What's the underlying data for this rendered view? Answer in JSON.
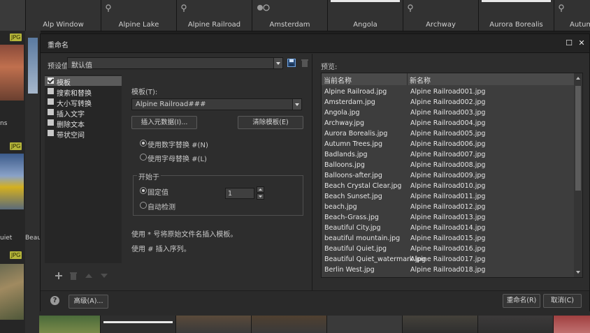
{
  "background": {
    "thumbnail_captions": [
      "Alp Window",
      "Alpine Lake",
      "Alpine Railroad",
      "Amsterdam",
      "Angola",
      "Archway",
      "Aurora Borealis",
      "Autumn"
    ],
    "side_badges": [
      "JPG",
      "JPG",
      "JPG"
    ],
    "side_captions": [
      "ns",
      "uiet",
      "Beau"
    ]
  },
  "dialog": {
    "title": "重命名",
    "maximize_glyph": "☐",
    "close_glyph": "✕",
    "preset_label": "预设值",
    "preset_value": "默认值",
    "template_items": [
      {
        "label": "模板",
        "checked": true,
        "selected": true
      },
      {
        "label": "搜索和替换",
        "checked": false,
        "selected": false
      },
      {
        "label": "大小写转换",
        "checked": false,
        "selected": false
      },
      {
        "label": "插入文字",
        "checked": false,
        "selected": false
      },
      {
        "label": "删除文本",
        "checked": false,
        "selected": false
      },
      {
        "label": "带状空间",
        "checked": false,
        "selected": false
      }
    ],
    "template_label": "模板(T):",
    "template_value": "Alpine Railroad###",
    "insert_metadata_button": "插入元数据(I)...",
    "clear_template_button": "清除模板(E)",
    "use_number_replace": "使用数字替换 #(N)",
    "use_letter_replace": "使用字母替换 #(L)",
    "start_at_label": "开始于",
    "fixed_value_label": "固定值",
    "auto_detect_label": "自动检测",
    "start_value": "1",
    "hint_line1": "使用 * 号将原始文件名插入模板。",
    "hint_line2": "使用 # 插入序列。",
    "preview_label": "预览:",
    "col_current": "当前名称",
    "col_new": "新名称",
    "preview_rows": [
      [
        "Alpine Railroad.jpg",
        "Alpine Railroad001.jpg"
      ],
      [
        "Amsterdam.jpg",
        "Alpine Railroad002.jpg"
      ],
      [
        "Angola.jpg",
        "Alpine Railroad003.jpg"
      ],
      [
        "Archway.jpg",
        "Alpine Railroad004.jpg"
      ],
      [
        "Aurora Borealis.jpg",
        "Alpine Railroad005.jpg"
      ],
      [
        "Autumn Trees.jpg",
        "Alpine Railroad006.jpg"
      ],
      [
        "Badlands.jpg",
        "Alpine Railroad007.jpg"
      ],
      [
        "Balloons.jpg",
        "Alpine Railroad008.jpg"
      ],
      [
        "Balloons-after.jpg",
        "Alpine Railroad009.jpg"
      ],
      [
        "Beach Crystal Clear.jpg",
        "Alpine Railroad010.jpg"
      ],
      [
        "Beach Sunset.jpg",
        "Alpine Railroad011.jpg"
      ],
      [
        "beach.jpg",
        "Alpine Railroad012.jpg"
      ],
      [
        "Beach-Grass.jpg",
        "Alpine Railroad013.jpg"
      ],
      [
        "Beautiful City.jpg",
        "Alpine Railroad014.jpg"
      ],
      [
        "beautiful mountain.jpg",
        "Alpine Railroad015.jpg"
      ],
      [
        "Beautiful Quiet.jpg",
        "Alpine Railroad016.jpg"
      ],
      [
        "Beautiful Quiet_watermark.jpg",
        "Alpine Railroad017.jpg"
      ],
      [
        "Berlin West.jpg",
        "Alpine Railroad018.jpg"
      ]
    ],
    "help_glyph": "?",
    "advanced_button": "高级(A)...",
    "rename_button": "重命名(R)",
    "cancel_button": "取消(C)"
  },
  "colors": {
    "accent_blue": "#4a90d9",
    "badge": "#b5b53a"
  }
}
